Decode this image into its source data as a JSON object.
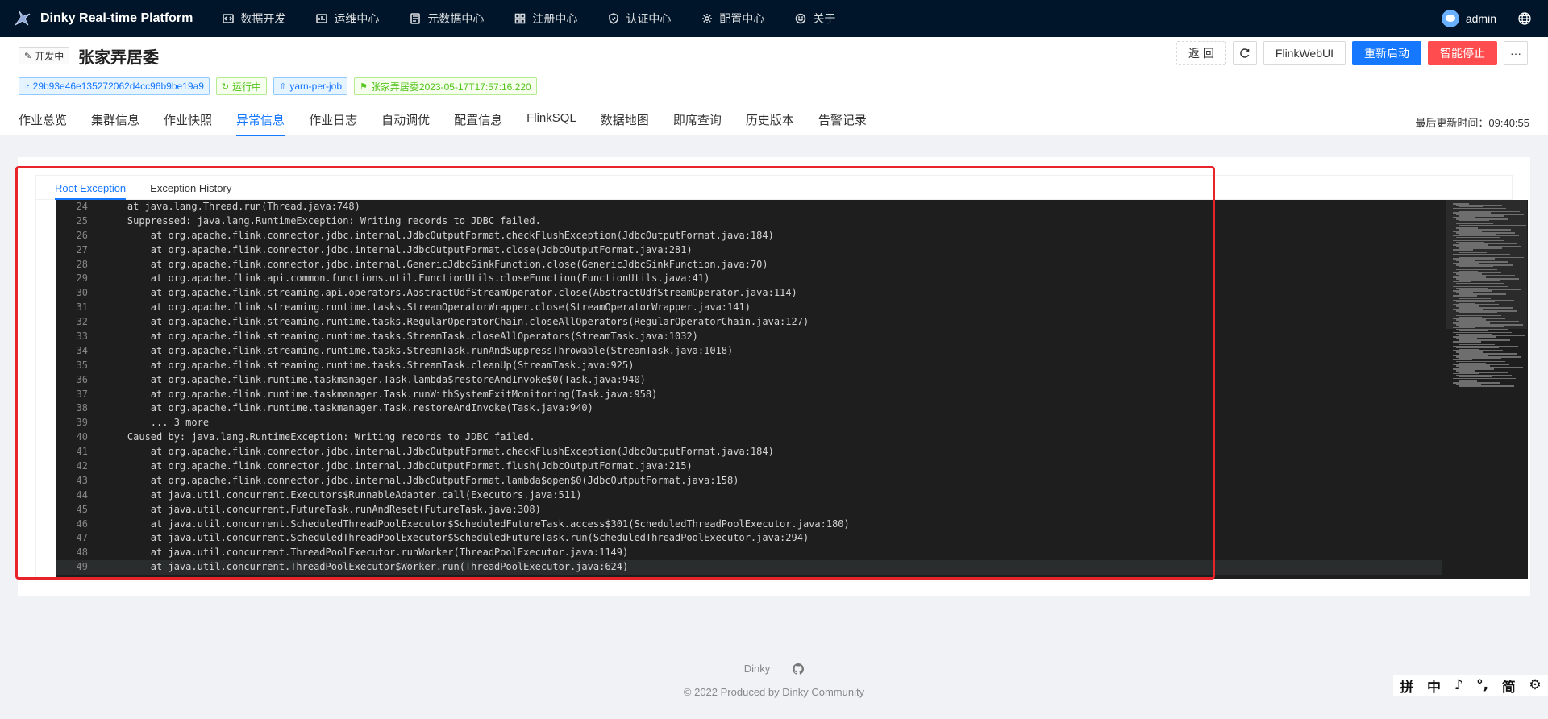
{
  "nav": {
    "brand": "Dinky Real-time Platform",
    "items": [
      {
        "label": "数据开发",
        "icon": "code-icon"
      },
      {
        "label": "运维中心",
        "icon": "monitor-icon"
      },
      {
        "label": "元数据中心",
        "icon": "database-icon"
      },
      {
        "label": "注册中心",
        "icon": "grid-icon"
      },
      {
        "label": "认证中心",
        "icon": "shield-icon"
      },
      {
        "label": "配置中心",
        "icon": "gear-icon"
      },
      {
        "label": "关于",
        "icon": "smile-icon"
      }
    ],
    "user": "admin"
  },
  "job": {
    "status_tag": "开发中",
    "title": "张家弄居委",
    "tags": [
      {
        "text": "29b93e46e135272062d4cc96b9be19a9",
        "color": "blue"
      },
      {
        "text": "运行中",
        "color": "green"
      },
      {
        "text": "yarn-per-job",
        "color": "blue"
      },
      {
        "text": "张家弄居委2023-05-17T17:57:16.220",
        "color": "green"
      }
    ]
  },
  "actions": {
    "back": "返 回",
    "flink_web_ui": "FlinkWebUI",
    "restart": "重新启动",
    "smart_stop": "智能停止",
    "more": "···"
  },
  "tabs": [
    "作业总览",
    "集群信息",
    "作业快照",
    "异常信息",
    "作业日志",
    "自动调优",
    "配置信息",
    "FlinkSQL",
    "数据地图",
    "即席查询",
    "历史版本",
    "告警记录"
  ],
  "active_tab": 3,
  "last_update": "最后更新时间：09:40:55",
  "subtabs": [
    "Root Exception",
    "Exception History"
  ],
  "code": [
    {
      "n": "24",
      "t": "    at java.lang.Thread.run(Thread.java:748)"
    },
    {
      "n": "25",
      "t": "    Suppressed: java.lang.RuntimeException: Writing records to JDBC failed."
    },
    {
      "n": "26",
      "t": "        at org.apache.flink.connector.jdbc.internal.JdbcOutputFormat.checkFlushException(JdbcOutputFormat.java:184)"
    },
    {
      "n": "27",
      "t": "        at org.apache.flink.connector.jdbc.internal.JdbcOutputFormat.close(JdbcOutputFormat.java:281)"
    },
    {
      "n": "28",
      "t": "        at org.apache.flink.connector.jdbc.internal.GenericJdbcSinkFunction.close(GenericJdbcSinkFunction.java:70)"
    },
    {
      "n": "29",
      "t": "        at org.apache.flink.api.common.functions.util.FunctionUtils.closeFunction(FunctionUtils.java:41)"
    },
    {
      "n": "30",
      "t": "        at org.apache.flink.streaming.api.operators.AbstractUdfStreamOperator.close(AbstractUdfStreamOperator.java:114)"
    },
    {
      "n": "31",
      "t": "        at org.apache.flink.streaming.runtime.tasks.StreamOperatorWrapper.close(StreamOperatorWrapper.java:141)"
    },
    {
      "n": "32",
      "t": "        at org.apache.flink.streaming.runtime.tasks.RegularOperatorChain.closeAllOperators(RegularOperatorChain.java:127)"
    },
    {
      "n": "33",
      "t": "        at org.apache.flink.streaming.runtime.tasks.StreamTask.closeAllOperators(StreamTask.java:1032)"
    },
    {
      "n": "34",
      "t": "        at org.apache.flink.streaming.runtime.tasks.StreamTask.runAndSuppressThrowable(StreamTask.java:1018)"
    },
    {
      "n": "35",
      "t": "        at org.apache.flink.streaming.runtime.tasks.StreamTask.cleanUp(StreamTask.java:925)"
    },
    {
      "n": "36",
      "t": "        at org.apache.flink.runtime.taskmanager.Task.lambda$restoreAndInvoke$0(Task.java:940)"
    },
    {
      "n": "37",
      "t": "        at org.apache.flink.runtime.taskmanager.Task.runWithSystemExitMonitoring(Task.java:958)"
    },
    {
      "n": "38",
      "t": "        at org.apache.flink.runtime.taskmanager.Task.restoreAndInvoke(Task.java:940)"
    },
    {
      "n": "39",
      "t": "        ... 3 more"
    },
    {
      "n": "40",
      "t": "    Caused by: java.lang.RuntimeException: Writing records to JDBC failed."
    },
    {
      "n": "41",
      "t": "        at org.apache.flink.connector.jdbc.internal.JdbcOutputFormat.checkFlushException(JdbcOutputFormat.java:184)"
    },
    {
      "n": "42",
      "t": "        at org.apache.flink.connector.jdbc.internal.JdbcOutputFormat.flush(JdbcOutputFormat.java:215)"
    },
    {
      "n": "43",
      "t": "        at org.apache.flink.connector.jdbc.internal.JdbcOutputFormat.lambda$open$0(JdbcOutputFormat.java:158)"
    },
    {
      "n": "44",
      "t": "        at java.util.concurrent.Executors$RunnableAdapter.call(Executors.java:511)"
    },
    {
      "n": "45",
      "t": "        at java.util.concurrent.FutureTask.runAndReset(FutureTask.java:308)"
    },
    {
      "n": "46",
      "t": "        at java.util.concurrent.ScheduledThreadPoolExecutor$ScheduledFutureTask.access$301(ScheduledThreadPoolExecutor.java:180)"
    },
    {
      "n": "47",
      "t": "        at java.util.concurrent.ScheduledThreadPoolExecutor$ScheduledFutureTask.run(ScheduledThreadPoolExecutor.java:294)"
    },
    {
      "n": "48",
      "t": "        at java.util.concurrent.ThreadPoolExecutor.runWorker(ThreadPoolExecutor.java:1149)"
    },
    {
      "n": "49",
      "t": "        at java.util.concurrent.ThreadPoolExecutor$Worker.run(ThreadPoolExecutor.java:624)"
    }
  ],
  "footer": {
    "link": "Dinky",
    "copyright": "© 2022 Produced by Dinky Community"
  },
  "ime": [
    "拼",
    "中",
    "♪",
    "°,",
    "简",
    "⚙"
  ],
  "colors": {
    "nav_bg": "#001529",
    "primary": "#1677ff",
    "danger": "#ff4d4f",
    "editor_bg": "#1e1e1e",
    "highlight_box": "#e8232a"
  }
}
